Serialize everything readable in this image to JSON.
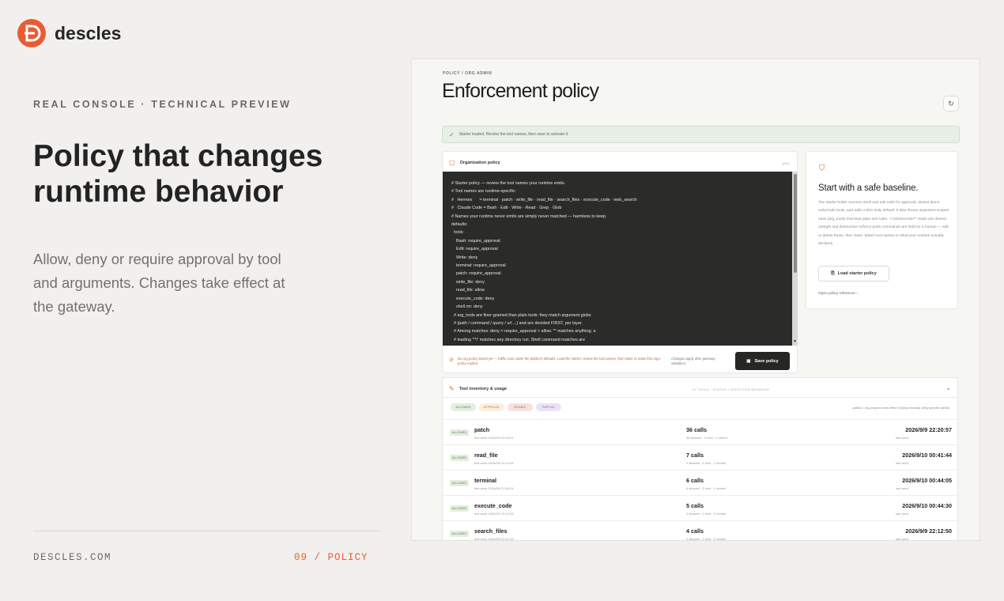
{
  "brand": {
    "name": "descles",
    "accent": "#e85c34"
  },
  "hero": {
    "eyebrow": "REAL CONSOLE · TECHNICAL PREVIEW",
    "headline": "Policy that changes runtime behavior",
    "lead": "Allow, deny or require approval by tool and arguments. Changes take effect at the gateway."
  },
  "footer": {
    "site": "DESCLES.COM",
    "page": "09 / POLICY"
  },
  "console": {
    "breadcrumb": "POLICY / ORG ADMIN",
    "title": "Enforcement policy",
    "refresh_icon": "refresh-icon",
    "alert": "Starter loaded. Review the tool names, then save to activate it.",
    "org_policy": {
      "label": "Organization policy",
      "tag": "yaml",
      "code": [
        "# Starter policy — review the tool names your runtime emits.",
        "# Tool names are runtime-specific:",
        "#   Hermes      = terminal · patch · write_file · read_file · search_files · execute_code · web_search",
        "#   Claude Code = Bash · Edit · Write · Read · Grep · Glob",
        "# Names your runtime never emits are simply never matched — harmless to keep.",
        "defaults:",
        "  tools:",
        "    Bash: require_approval",
        "    Edit: require_approval",
        "    Write: deny",
        "    terminal: require_approval",
        "    patch: require_approval",
        "    write_file: deny",
        "    read_file: allow",
        "    execute_code: deny",
        "    shell.rm: deny",
        "  # arg_tools are finer-grained than plain tools: they match argument globs",
        "  # (path / command / query / url ...) and are decided FIRST, per layer.",
        "  # Among matches: deny > require_approval > allow. '*' matches anything; a",
        "  # leading '**/' matches any directory run. Shell command matches are"
      ],
      "warning": "No org policy saved yet — traffic runs under the platform defaults. Load the starter, review the tool names, then Save to make this org's policy explicit.",
      "apply_note": "Changes apply after gateway validation.",
      "save_label": "Save policy"
    },
    "baseline": {
      "title": "Start with a safe baseline.",
      "body": "The starter holds common shell and edit tools for approval, denies direct write/code tools, and adds a $10 daily default. It also shows argument-scoped rules (arg_tools) that beat plain tool rules: ~/.ssh/secrets/** reads are denied outright and destructive rs/force-push commands are held for a human — edit or delete those, then Save. Match tool names to what your runtime actually declares.",
      "button_label": "Load starter policy",
      "link_label": "Open policy reference"
    },
    "inventory": {
      "label": "Tool inventory & usage",
      "right_meta": "21 TOOLS · STATUS = EFFECTIVE BEHAVIOR",
      "legend": [
        "ALLOWED",
        "APPROVAL",
        "DENIED",
        "PARTIAL"
      ],
      "legend_note": "partial = arg-scoped rules refine it (allow broadly, deny specific paths)",
      "rows": [
        {
          "badge": "ALLOWED",
          "name": "patch",
          "seen": "first seen 2026/9/9 22:15:01",
          "calls": "36 calls",
          "calls_sub": "36 allowed · 0 held · 0 denied",
          "last": "2026/9/9 22:20:57",
          "last_sub": "last used"
        },
        {
          "badge": "ALLOWED",
          "name": "read_file",
          "seen": "first seen 2026/9/9 22:12:08",
          "calls": "7 calls",
          "calls_sub": "3 allowed · 0 held · 4 denied",
          "last": "2026/9/10 00:41:44",
          "last_sub": "last used"
        },
        {
          "badge": "ALLOWED",
          "name": "terminal",
          "seen": "first seen 2026/9/9 21:54:34",
          "calls": "6 calls",
          "calls_sub": "6 allowed · 0 held · 0 denied",
          "last": "2026/9/10 00:44:05",
          "last_sub": "last used"
        },
        {
          "badge": "ALLOWED",
          "name": "execute_code",
          "seen": "first seen 2026/9/9 22:12:08",
          "calls": "5 calls",
          "calls_sub": "5 allowed · 0 held · 0 denied",
          "last": "2026/9/10 00:44:30",
          "last_sub": "last used"
        },
        {
          "badge": "ALLOWED",
          "name": "search_files",
          "seen": "first seen 2026/9/9 22:12:16",
          "calls": "4 calls",
          "calls_sub": "4 allowed · 0 held · 0 denied",
          "last": "2026/9/9 22:12:50",
          "last_sub": "last used"
        }
      ]
    }
  }
}
